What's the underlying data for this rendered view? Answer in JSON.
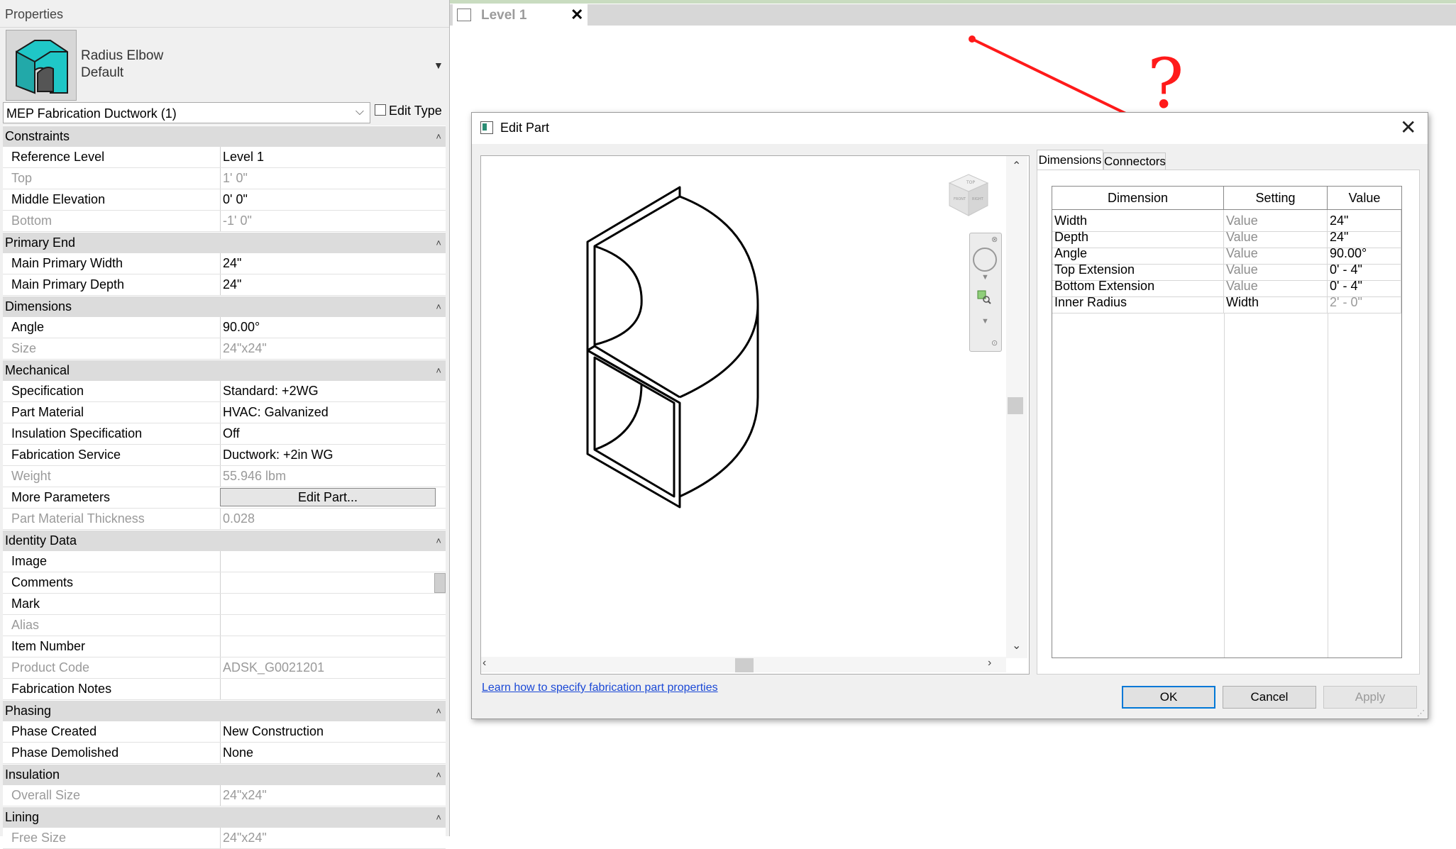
{
  "properties": {
    "title": "Properties",
    "type_name": "Radius Elbow",
    "type_sub": "Default",
    "instance_selector": "MEP Fabrication Ductwork (1)",
    "edit_type_label": "Edit Type",
    "groups": {
      "constraints": "Constraints",
      "primary_end": "Primary End",
      "dimensions": "Dimensions",
      "mechanical": "Mechanical",
      "identity": "Identity Data",
      "phasing": "Phasing",
      "insulation": "Insulation",
      "lining": "Lining"
    },
    "rows": {
      "reference_level": {
        "k": "Reference Level",
        "v": "Level 1"
      },
      "top": {
        "k": "Top",
        "v": "1'  0\""
      },
      "middle_elevation": {
        "k": "Middle Elevation",
        "v": "0'  0\""
      },
      "bottom": {
        "k": "Bottom",
        "v": "-1'  0\""
      },
      "main_primary_width": {
        "k": "Main Primary Width",
        "v": "24\""
      },
      "main_primary_depth": {
        "k": "Main Primary Depth",
        "v": "24\""
      },
      "angle": {
        "k": "Angle",
        "v": "90.00°"
      },
      "size": {
        "k": "Size",
        "v": "24\"x24\""
      },
      "specification": {
        "k": "Specification",
        "v": "Standard: +2WG"
      },
      "part_material": {
        "k": "Part Material",
        "v": "HVAC: Galvanized"
      },
      "insulation_spec": {
        "k": "Insulation Specification",
        "v": "Off"
      },
      "fabrication_service": {
        "k": "Fabrication Service",
        "v": "Ductwork: +2in WG"
      },
      "weight": {
        "k": "Weight",
        "v": "55.946 lbm"
      },
      "more_parameters": {
        "k": "More Parameters",
        "v": "Edit Part..."
      },
      "part_material_thickness": {
        "k": "Part Material Thickness",
        "v": "0.028"
      },
      "image": {
        "k": "Image",
        "v": ""
      },
      "comments": {
        "k": "Comments",
        "v": ""
      },
      "mark": {
        "k": "Mark",
        "v": ""
      },
      "alias": {
        "k": "Alias",
        "v": ""
      },
      "item_number": {
        "k": "Item Number",
        "v": ""
      },
      "product_code": {
        "k": "Product Code",
        "v": "ADSK_G0021201"
      },
      "fabrication_notes": {
        "k": "Fabrication Notes",
        "v": ""
      },
      "phase_created": {
        "k": "Phase Created",
        "v": "New Construction"
      },
      "phase_demolished": {
        "k": "Phase Demolished",
        "v": "None"
      },
      "overall_size": {
        "k": "Overall Size",
        "v": "24\"x24\""
      },
      "free_size": {
        "k": "Free Size",
        "v": "24\"x24\""
      }
    }
  },
  "view_tab": {
    "label": "Level 1"
  },
  "annotation": {
    "question_mark": "?",
    "arrow_color": "#ff1a1a"
  },
  "dialog": {
    "title": "Edit Part",
    "tabs": [
      "Dimensions",
      "Connectors"
    ],
    "table_headers": [
      "Dimension",
      "Setting",
      "Value"
    ],
    "rows": [
      {
        "dimension": "Width",
        "setting": "Value",
        "value": "24\""
      },
      {
        "dimension": "Depth",
        "setting": "Value",
        "value": "24\""
      },
      {
        "dimension": "Angle",
        "setting": "Value",
        "value": "90.00°"
      },
      {
        "dimension": "Top Extension",
        "setting": "Value",
        "value": "0' - 4\""
      },
      {
        "dimension": "Bottom Extension",
        "setting": "Value",
        "value": "0' - 4\""
      },
      {
        "dimension": "Inner Radius",
        "setting": "Width",
        "value": "2' - 0\""
      }
    ],
    "help_link": "Learn how to specify fabrication part properties",
    "buttons": {
      "ok": "OK",
      "cancel": "Cancel",
      "apply": "Apply"
    },
    "viewcube_faces": {
      "top": "TOP",
      "front": "FRONT",
      "right": "RIGHT"
    }
  },
  "colors": {
    "accent": "#0078d7",
    "part_cyan": "#1fc7c7",
    "link": "#1a48d6"
  }
}
